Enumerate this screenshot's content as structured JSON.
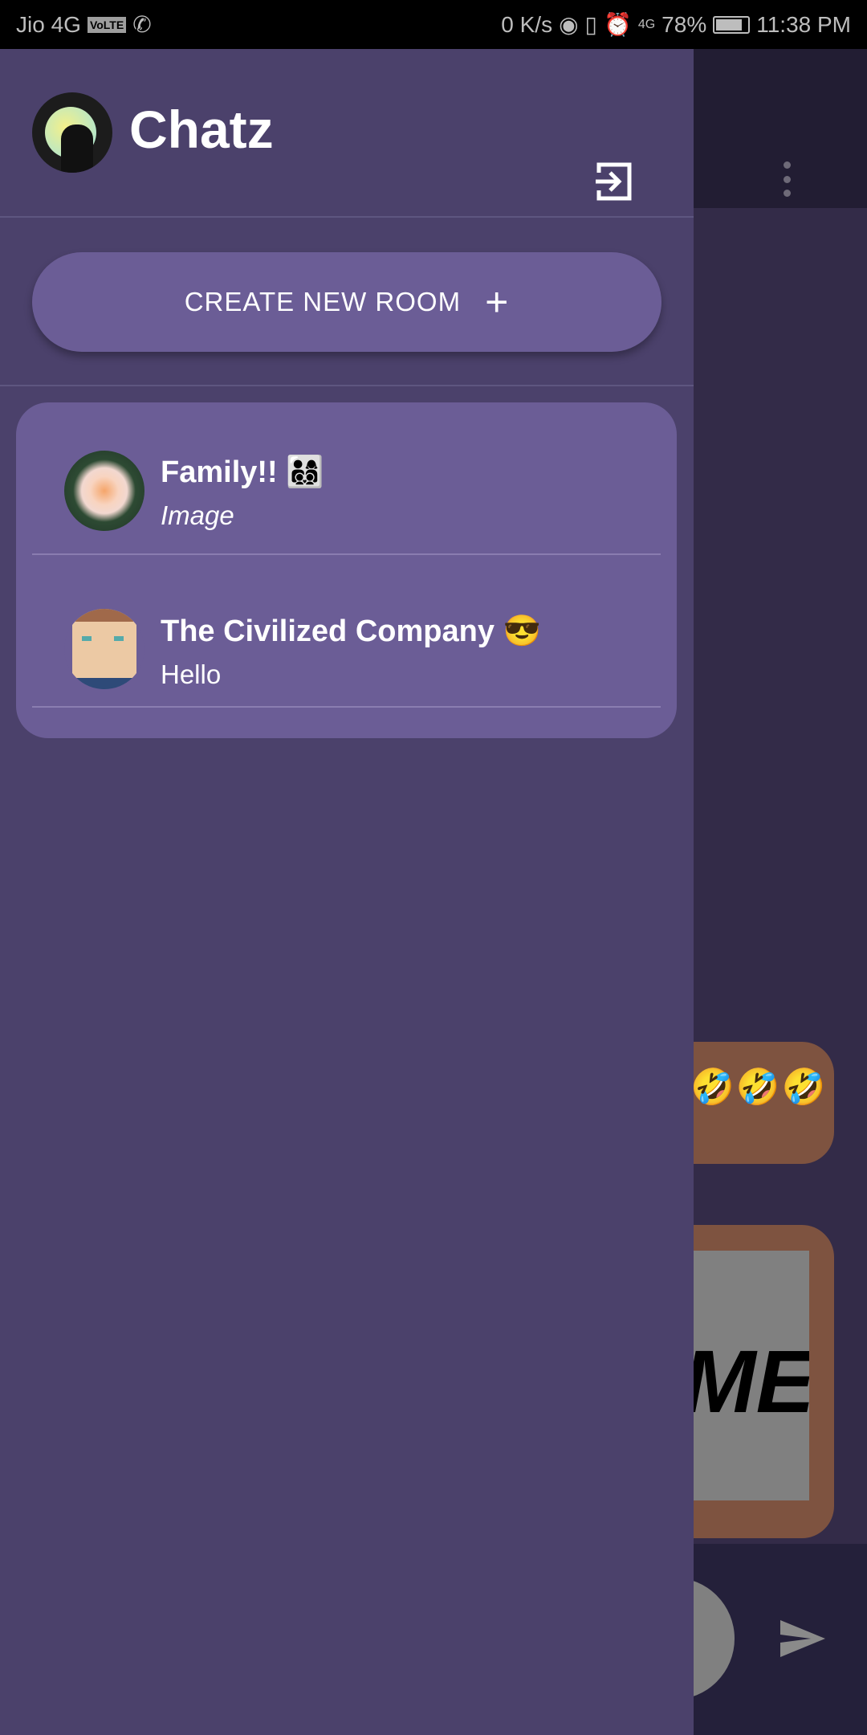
{
  "status_bar": {
    "carrier": "Jio 4G",
    "volte": "VoLTE",
    "speed": "0 K/s",
    "hotspot_count": "1",
    "network": "4G",
    "battery": "78%",
    "time": "11:38 PM"
  },
  "app": {
    "title": "Chatz"
  },
  "drawer": {
    "create_room_label": "CREATE NEW ROOM",
    "create_room_icon": "plus-icon"
  },
  "rooms": [
    {
      "name": "Family!! 👨‍👩‍👦‍👦",
      "last_message": "Image"
    },
    {
      "name": "The Civilized Company 😎",
      "last_message": "Hello"
    }
  ],
  "chat": {
    "bubble_emojis": "🤣🤣🤣",
    "image_text": "ME!"
  },
  "colors": {
    "drawer": "#4b416b",
    "card": "#6b5d96",
    "bubble": "#7e5340"
  }
}
